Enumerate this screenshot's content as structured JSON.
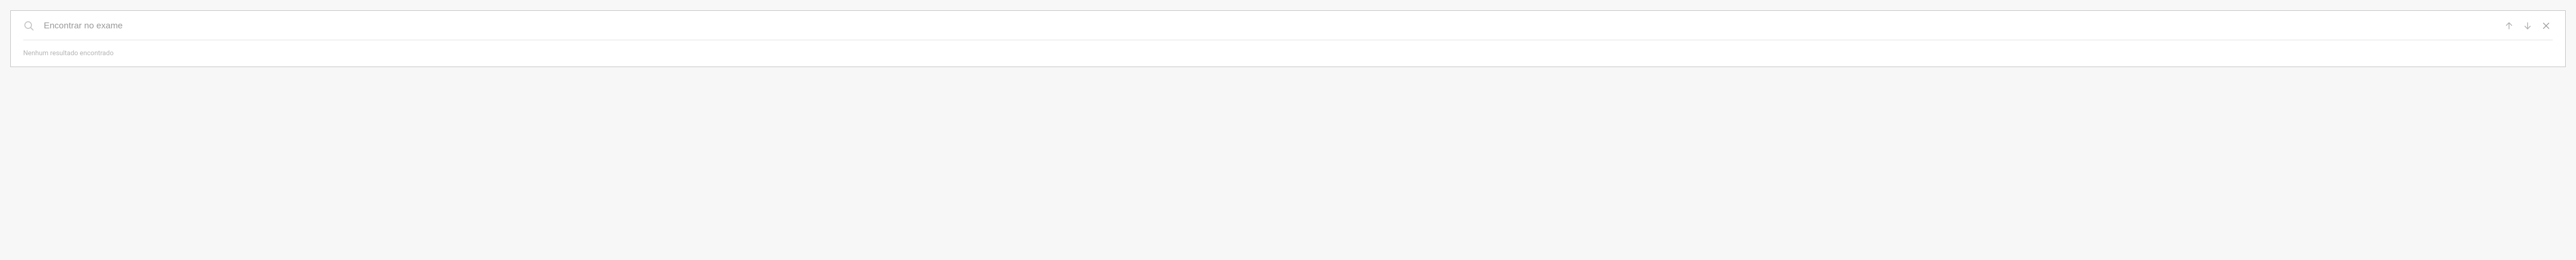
{
  "search": {
    "placeholder": "Encontrar no exame",
    "value": ""
  },
  "status": {
    "no_results": "Nenhum resultado encontrado"
  }
}
